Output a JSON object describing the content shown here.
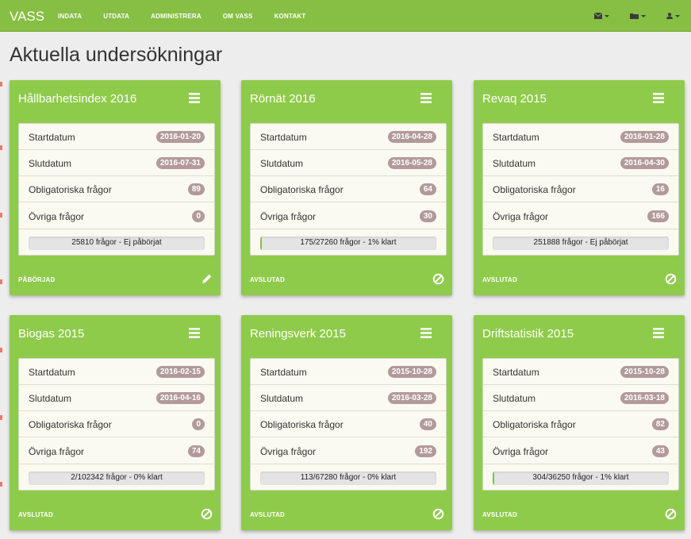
{
  "nav": {
    "brand": "VASS",
    "links": [
      "INDATA",
      "UTDATA",
      "ADMINISTRERA",
      "OM VASS",
      "KONTAKT"
    ],
    "right_icons": [
      "envelope-icon",
      "folder-icon",
      "user-icon"
    ]
  },
  "page": {
    "title": "Aktuella undersökningar"
  },
  "cards": [
    {
      "title": "Hållbarhetsindex 2016",
      "stats": [
        {
          "label": "Startdatum",
          "value": "2016-01-20"
        },
        {
          "label": "Slutdatum",
          "value": "2016-07-31"
        },
        {
          "label": "Obligatoriska frågor",
          "value": "89"
        },
        {
          "label": "Övriga frågor",
          "value": "0"
        }
      ],
      "progress_text": "25810 frågor - Ej påbörjat",
      "progress_fraction": 0,
      "status": "PÅBÖRJAD",
      "action_icon": "pencil-icon"
    },
    {
      "title": "Rörnät 2016",
      "stats": [
        {
          "label": "Startdatum",
          "value": "2016-04-28"
        },
        {
          "label": "Slutdatum",
          "value": "2016-05-28"
        },
        {
          "label": "Obligatoriska frågor",
          "value": "64"
        },
        {
          "label": "Övriga frågor",
          "value": "30"
        }
      ],
      "progress_text": "175/27260 frågor - 1% klart",
      "progress_fraction": 0.01,
      "status": "AVSLUTAD",
      "action_icon": "ban-icon"
    },
    {
      "title": "Revaq 2015",
      "stats": [
        {
          "label": "Startdatum",
          "value": "2016-01-28"
        },
        {
          "label": "Slutdatum",
          "value": "2016-04-30"
        },
        {
          "label": "Obligatoriska frågor",
          "value": "16"
        },
        {
          "label": "Övriga frågor",
          "value": "166"
        }
      ],
      "progress_text": "251888 frågor - Ej påbörjat",
      "progress_fraction": 0,
      "status": "AVSLUTAD",
      "action_icon": "ban-icon"
    },
    {
      "title": "Biogas 2015",
      "stats": [
        {
          "label": "Startdatum",
          "value": "2016-02-15"
        },
        {
          "label": "Slutdatum",
          "value": "2016-04-16"
        },
        {
          "label": "Obligatoriska frågor",
          "value": "0"
        },
        {
          "label": "Övriga frågor",
          "value": "74"
        }
      ],
      "progress_text": "2/102342 frågor - 0% klart",
      "progress_fraction": 0,
      "status": "AVSLUTAD",
      "action_icon": "ban-icon"
    },
    {
      "title": "Reningsverk 2015",
      "stats": [
        {
          "label": "Startdatum",
          "value": "2015-10-28"
        },
        {
          "label": "Slutdatum",
          "value": "2016-03-28"
        },
        {
          "label": "Obligatoriska frågor",
          "value": "40"
        },
        {
          "label": "Övriga frågor",
          "value": "192"
        }
      ],
      "progress_text": "113/67280 frågor - 0% klart",
      "progress_fraction": 0,
      "status": "AVSLUTAD",
      "action_icon": "ban-icon"
    },
    {
      "title": "Driftstatistik 2015",
      "stats": [
        {
          "label": "Startdatum",
          "value": "2015-10-28"
        },
        {
          "label": "Slutdatum",
          "value": "2016-03-18"
        },
        {
          "label": "Obligatoriska frågor",
          "value": "82"
        },
        {
          "label": "Övriga frågor",
          "value": "43"
        }
      ],
      "progress_text": "304/36250 frågor - 1% klart",
      "progress_fraction": 0.01,
      "status": "AVSLUTAD",
      "action_icon": "ban-icon"
    }
  ],
  "colors": {
    "navbar": "#86bf43",
    "card": "#8fcb4a",
    "badge": "#b39a9a",
    "progress_fill": "#86bf43"
  }
}
